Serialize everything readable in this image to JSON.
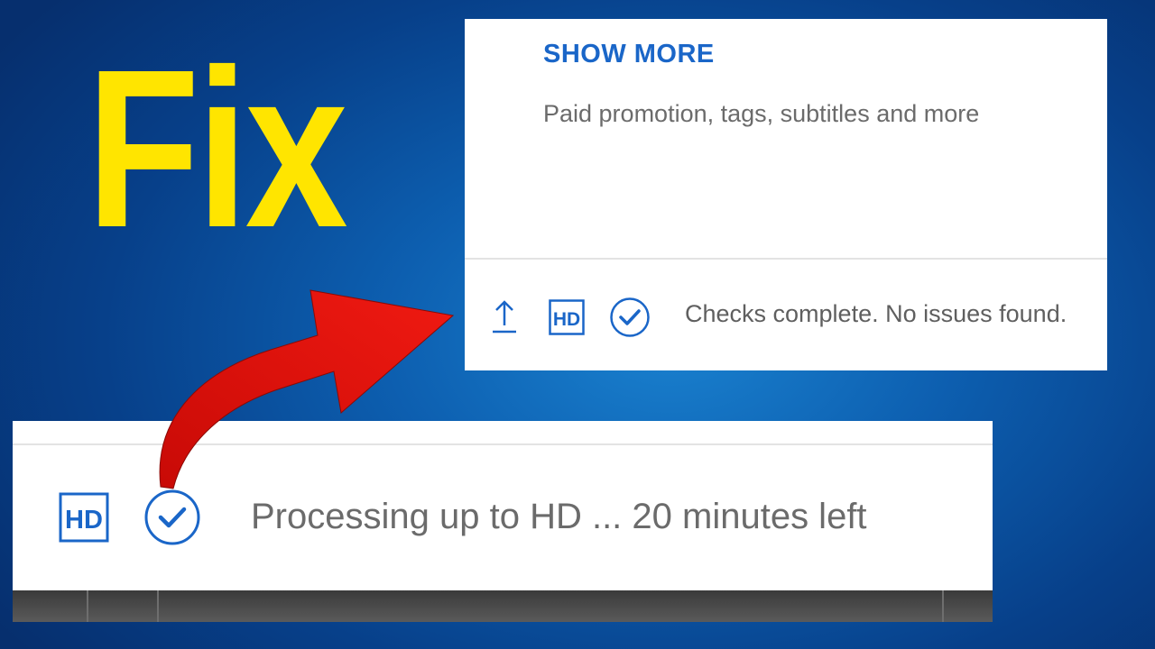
{
  "headline": {
    "text": "Fix"
  },
  "top_panel": {
    "show_more_label": "SHOW MORE",
    "show_more_subtitle": "Paid promotion, tags, subtitles and more",
    "status_bar": {
      "upload_icon": "upload-icon",
      "hd_badge": "HD",
      "check_icon": "check-circle-icon",
      "status_text": "Checks complete. No issues found."
    }
  },
  "bottom_panel": {
    "hd_badge": "HD",
    "check_icon": "check-circle-icon",
    "status_text": "Processing up to HD ... 20 minutes left"
  },
  "colors": {
    "headline": "#ffe500",
    "accent_blue": "#1a66c8",
    "arrow_red": "#e8120c",
    "background": "#0d5fb0"
  }
}
